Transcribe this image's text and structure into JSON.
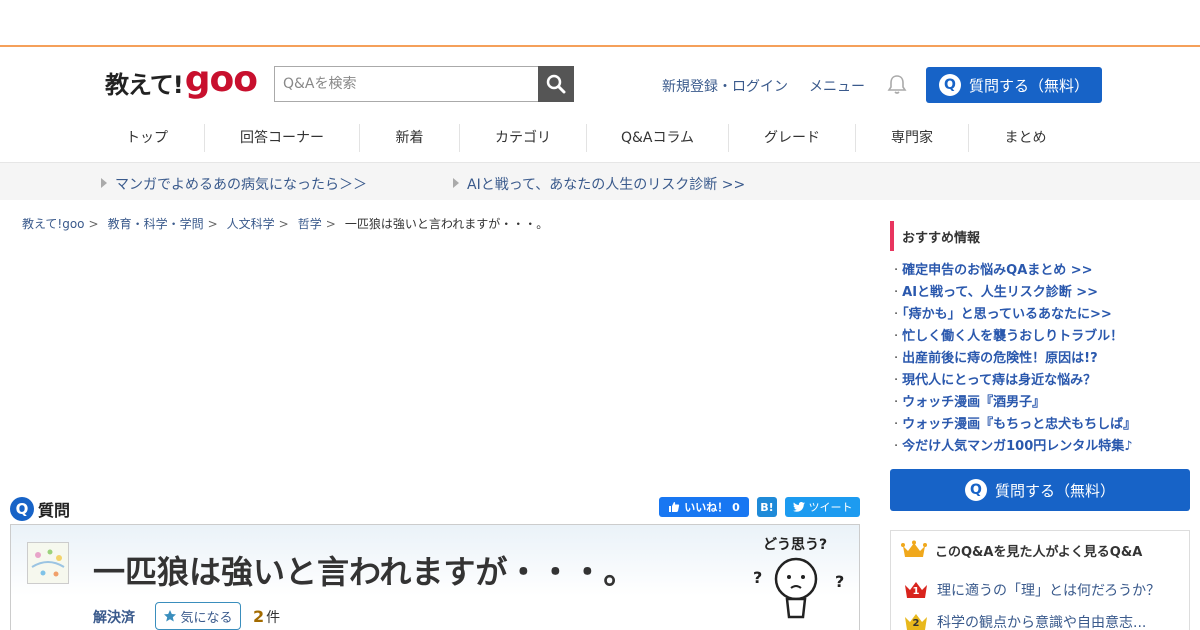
{
  "header": {
    "logo_jp": "教えて!",
    "logo_goo": "goo",
    "search_placeholder": "Q&Aを検索",
    "signup_login": "新規登録・ログイン",
    "menu": "メニュー",
    "ask_button": "質問する（無料）"
  },
  "nav": [
    "トップ",
    "回答コーナー",
    "新着",
    "カテゴリ",
    "Q&Aコラム",
    "グレード",
    "専門家",
    "まとめ"
  ],
  "banner": [
    "マンガでよめるあの病気になったら＞＞",
    "AIと戦って、あなたの人生のリスク診断 >>"
  ],
  "breadcrumb": [
    "教えて!goo",
    "教育・科学・学問",
    "人文科学",
    "哲学"
  ],
  "breadcrumb_separator": ">",
  "breadcrumb_current": "一匹狼は強いと言われますが・・・。",
  "question": {
    "label": "質問",
    "like": "いいね！ 0",
    "hatena": "B!",
    "tweet": "ツイート",
    "title": "一匹狼は強いと言われますが・・・。",
    "status": "解決済",
    "watch": "気になる",
    "answer_count": "2",
    "count_unit": "件",
    "doushi": "どう思う?"
  },
  "sidebar": {
    "recommended_title": "おすすめ情報",
    "recommended": [
      "確定申告のお悩みQAまとめ >>",
      "AIと戦って、人生リスク診断 >>",
      "「痔かも」と思っているあなたに>>",
      "忙しく働く人を襲うおしりトラブル！",
      "出産前後に痔の危険性！原因は!?",
      "現代人にとって痔は身近な悩み？",
      "ウォッチ漫画『酒男子』",
      "ウォッチ漫画『もちっと忠犬もちしば』",
      "今だけ人気マンガ100円レンタル特集♪"
    ],
    "ask_button": "質問する（無料）",
    "also_title": "このQ&Aを見た人がよく見るQ&A",
    "also_items": [
      {
        "rank": "1",
        "text": "理に適うの「理」とは何だろうか？"
      },
      {
        "rank": "2",
        "text": "科学の観点から意識や自由意志..."
      }
    ]
  },
  "colors": {
    "accent_blue": "#1763c7",
    "link_blue": "#3a5a8c",
    "orange_border": "#f5a05a",
    "pink_bar": "#e8355f",
    "logo_red": "#c8102e"
  }
}
